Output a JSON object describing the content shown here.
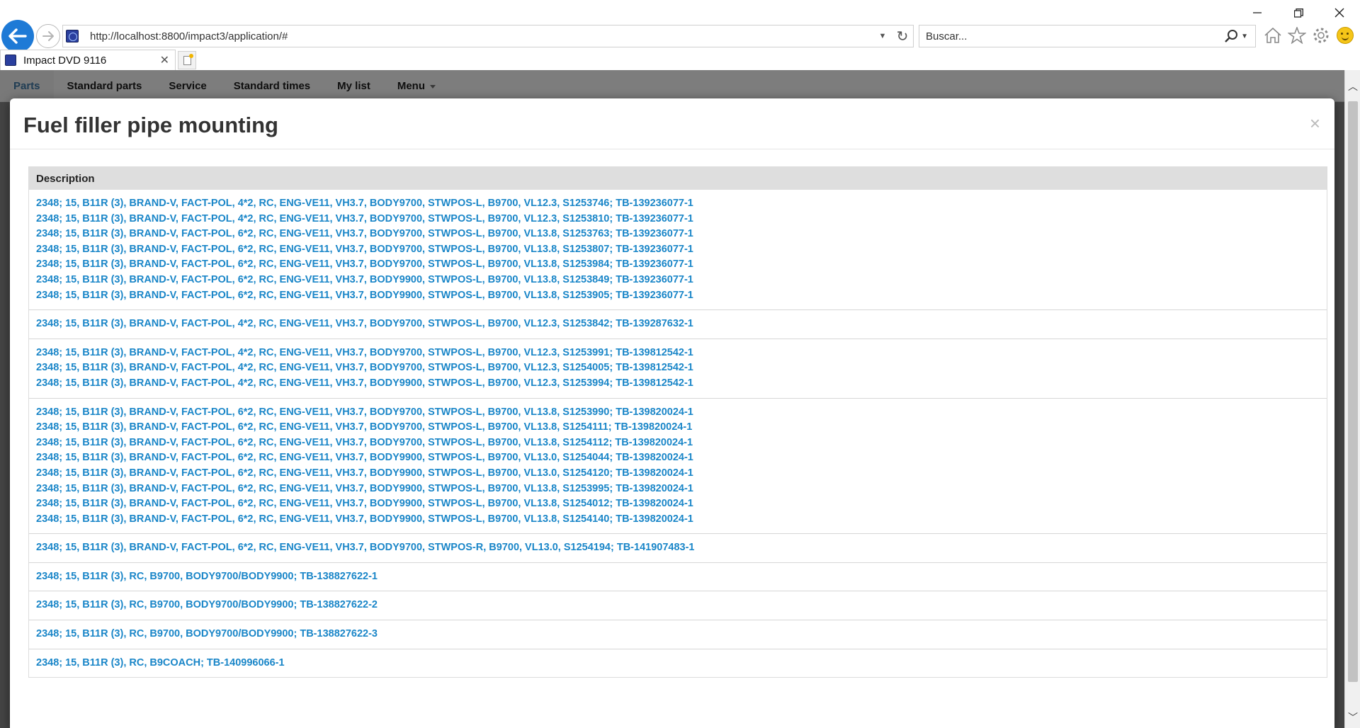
{
  "browser": {
    "url": "http://localhost:8800/impact3/application/#",
    "search_placeholder": "Buscar...",
    "tab_title": "Impact DVD 9116"
  },
  "nav": {
    "items": [
      "Parts",
      "Standard parts",
      "Service",
      "Standard times",
      "My list",
      "Menu"
    ],
    "active": "Parts"
  },
  "modal": {
    "title": "Fuel filler pipe mounting",
    "close_label": "×",
    "column_header": "Description",
    "groups": [
      [
        "2348; 15, B11R (3), BRAND-V, FACT-POL, 4*2, RC, ENG-VE11, VH3.7, BODY9700, STWPOS-L, B9700, VL12.3, S1253746; TB-139236077-1",
        "2348; 15, B11R (3), BRAND-V, FACT-POL, 4*2, RC, ENG-VE11, VH3.7, BODY9700, STWPOS-L, B9700, VL12.3, S1253810; TB-139236077-1",
        "2348; 15, B11R (3), BRAND-V, FACT-POL, 6*2, RC, ENG-VE11, VH3.7, BODY9700, STWPOS-L, B9700, VL13.8, S1253763; TB-139236077-1",
        "2348; 15, B11R (3), BRAND-V, FACT-POL, 6*2, RC, ENG-VE11, VH3.7, BODY9700, STWPOS-L, B9700, VL13.8, S1253807; TB-139236077-1",
        "2348; 15, B11R (3), BRAND-V, FACT-POL, 6*2, RC, ENG-VE11, VH3.7, BODY9700, STWPOS-L, B9700, VL13.8, S1253984; TB-139236077-1",
        "2348; 15, B11R (3), BRAND-V, FACT-POL, 6*2, RC, ENG-VE11, VH3.7, BODY9900, STWPOS-L, B9700, VL13.8, S1253849; TB-139236077-1",
        "2348; 15, B11R (3), BRAND-V, FACT-POL, 6*2, RC, ENG-VE11, VH3.7, BODY9900, STWPOS-L, B9700, VL13.8, S1253905; TB-139236077-1"
      ],
      [
        "2348; 15, B11R (3), BRAND-V, FACT-POL, 4*2, RC, ENG-VE11, VH3.7, BODY9700, STWPOS-L, B9700, VL12.3, S1253842; TB-139287632-1"
      ],
      [
        "2348; 15, B11R (3), BRAND-V, FACT-POL, 4*2, RC, ENG-VE11, VH3.7, BODY9700, STWPOS-L, B9700, VL12.3, S1253991; TB-139812542-1",
        "2348; 15, B11R (3), BRAND-V, FACT-POL, 4*2, RC, ENG-VE11, VH3.7, BODY9700, STWPOS-L, B9700, VL12.3, S1254005; TB-139812542-1",
        "2348; 15, B11R (3), BRAND-V, FACT-POL, 4*2, RC, ENG-VE11, VH3.7, BODY9900, STWPOS-L, B9700, VL12.3, S1253994; TB-139812542-1"
      ],
      [
        "2348; 15, B11R (3), BRAND-V, FACT-POL, 6*2, RC, ENG-VE11, VH3.7, BODY9700, STWPOS-L, B9700, VL13.8, S1253990; TB-139820024-1",
        "2348; 15, B11R (3), BRAND-V, FACT-POL, 6*2, RC, ENG-VE11, VH3.7, BODY9700, STWPOS-L, B9700, VL13.8, S1254111; TB-139820024-1",
        "2348; 15, B11R (3), BRAND-V, FACT-POL, 6*2, RC, ENG-VE11, VH3.7, BODY9700, STWPOS-L, B9700, VL13.8, S1254112; TB-139820024-1",
        "2348; 15, B11R (3), BRAND-V, FACT-POL, 6*2, RC, ENG-VE11, VH3.7, BODY9900, STWPOS-L, B9700, VL13.0, S1254044; TB-139820024-1",
        "2348; 15, B11R (3), BRAND-V, FACT-POL, 6*2, RC, ENG-VE11, VH3.7, BODY9900, STWPOS-L, B9700, VL13.0, S1254120; TB-139820024-1",
        "2348; 15, B11R (3), BRAND-V, FACT-POL, 6*2, RC, ENG-VE11, VH3.7, BODY9900, STWPOS-L, B9700, VL13.8, S1253995; TB-139820024-1",
        "2348; 15, B11R (3), BRAND-V, FACT-POL, 6*2, RC, ENG-VE11, VH3.7, BODY9900, STWPOS-L, B9700, VL13.8, S1254012; TB-139820024-1",
        "2348; 15, B11R (3), BRAND-V, FACT-POL, 6*2, RC, ENG-VE11, VH3.7, BODY9900, STWPOS-L, B9700, VL13.8, S1254140; TB-139820024-1"
      ],
      [
        "2348; 15, B11R (3), BRAND-V, FACT-POL, 6*2, RC, ENG-VE11, VH3.7, BODY9700, STWPOS-R, B9700, VL13.0, S1254194; TB-141907483-1"
      ],
      [
        "2348; 15, B11R (3), RC, B9700, BODY9700/BODY9900; TB-138827622-1"
      ],
      [
        "2348; 15, B11R (3), RC, B9700, BODY9700/BODY9900; TB-138827622-2"
      ],
      [
        "2348; 15, B11R (3), RC, B9700, BODY9700/BODY9900; TB-138827622-3"
      ],
      [
        "2348; 15, B11R (3), RC, B9COACH; TB-140996066-1"
      ]
    ]
  },
  "colors": {
    "link": "#1a86c8",
    "nav_active": "#3b6f99",
    "back_button": "#1e7ad6"
  }
}
